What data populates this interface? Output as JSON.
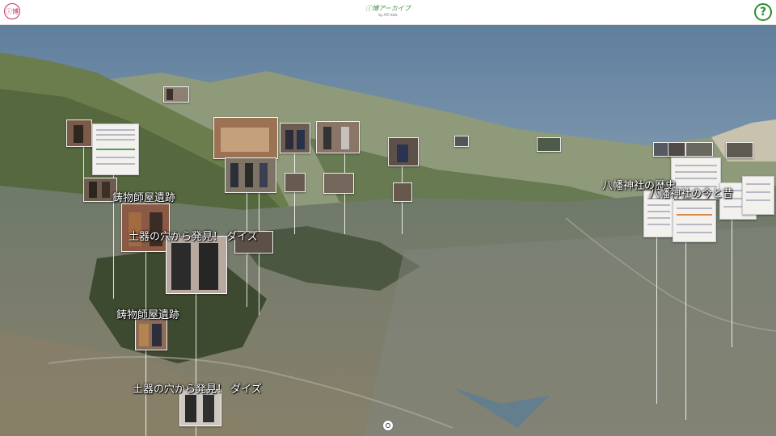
{
  "header": {
    "logo_text": "ⓘ博",
    "title": "ⓘ博アーカイブ",
    "subtitle": "by ATC Kids",
    "help_label": "?"
  },
  "map": {
    "labels": {
      "label_1": "鋳物師屋遺跡",
      "label_2": "土器の穴から発見！ ダイズ",
      "label_3": "鋳物師屋遺跡",
      "label_4": "土器の穴から発見！ ダイズ",
      "label_5": "八幡神社の歴史",
      "label_6": "八幡神社の今と昔"
    }
  },
  "colors": {
    "sky": "#6f8aa6",
    "mountain": "#7a8a5a",
    "accent_brand": "#3c8a3c",
    "logo": "#c0306a"
  },
  "icons": {
    "logo": "info-museum-icon",
    "help": "question-icon",
    "compass": "compass-icon"
  }
}
